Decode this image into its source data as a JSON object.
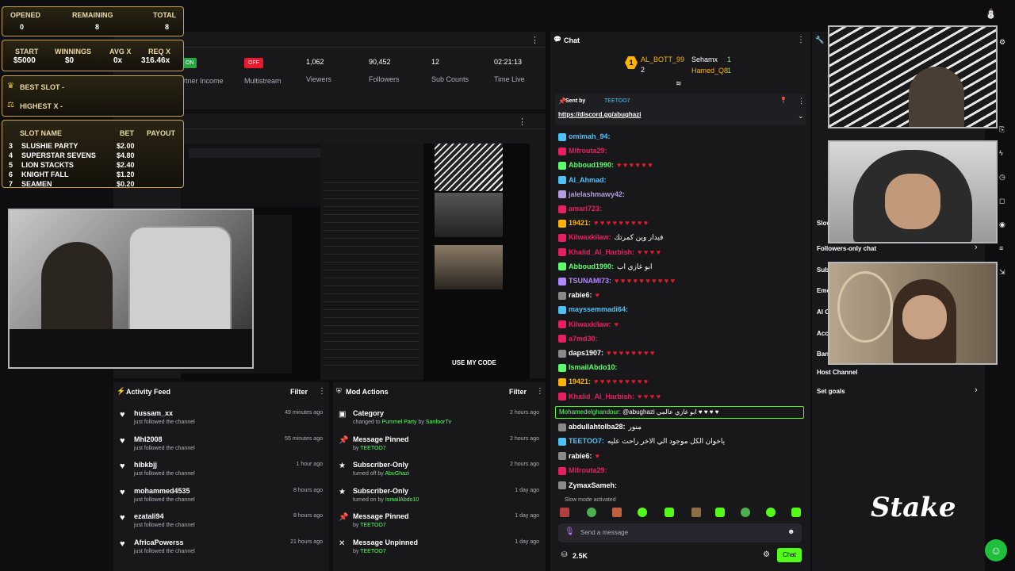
{
  "overlay": {
    "stats_header": {
      "opened_label": "OPENED",
      "remaining_label": "REMAINING",
      "total_label": "TOTAL",
      "opened": "0",
      "remaining": "8",
      "total": "8"
    },
    "money": {
      "start_label": "START",
      "winnings_label": "WINNINGS",
      "avg_label": "AVG X",
      "req_label": "REQ X",
      "start": "$5000",
      "winnings": "$0",
      "avg": "0x",
      "req": "316.46x"
    },
    "best_slot": "BEST SLOT -",
    "highest_x": "HIGHEST X -",
    "slot_table": {
      "headers": [
        "SLOT NAME",
        "BET",
        "PAYOUT"
      ],
      "rows": [
        {
          "n": "3",
          "name": "SLUSHIE PARTY",
          "bet": "$2.00"
        },
        {
          "n": "4",
          "name": "SUPERSTAR SEVENS",
          "bet": "$4.80"
        },
        {
          "n": "5",
          "name": "LION STACKTS",
          "bet": "$2.40"
        },
        {
          "n": "6",
          "name": "KNIGHT FALL",
          "bet": "$1.20"
        },
        {
          "n": "7",
          "name": "SEAMEN",
          "bet": "$0.20"
        }
      ]
    },
    "brand": "Stake"
  },
  "dashboard": {
    "on_label": "ON",
    "off_label": "OFF",
    "partner_income": "rtner Income",
    "multistream": "Multistream",
    "stats": [
      {
        "value": "1,062",
        "label": "Viewers"
      },
      {
        "value": "90,452",
        "label": "Followers"
      },
      {
        "value": "12",
        "label": "Sub Counts"
      },
      {
        "value": "02:21:13",
        "label": "Time Live"
      }
    ]
  },
  "preview": {
    "my_code": "USE MY CODE"
  },
  "activity_feed": {
    "title": "Activity Feed",
    "filter": "Filter",
    "items": [
      {
        "user": "hussam_xx",
        "action": "just followed the channel",
        "time": "49 minutes ago"
      },
      {
        "user": "Mhl2008",
        "action": "just followed the channel",
        "time": "55 minutes ago"
      },
      {
        "user": "hibkbjj",
        "action": "just followed the channel",
        "time": "1 hour ago"
      },
      {
        "user": "mohammed4535",
        "action": "just followed the channel",
        "time": "8 hours ago"
      },
      {
        "user": "ezatali94",
        "action": "just followed the channel",
        "time": "8 hours ago"
      },
      {
        "user": "AfricaPowerss",
        "action": "just followed the channel",
        "time": "21 hours ago"
      }
    ]
  },
  "mod_actions": {
    "title": "Mod Actions",
    "filter": "Filter",
    "items": [
      {
        "title": "Category",
        "pre": "changed to ",
        "value": "Pummel Party",
        "mid": " by ",
        "user": "SanfoorTv",
        "time": "2 hours ago",
        "icon": "category-icon"
      },
      {
        "title": "Message Pinned",
        "pre": "by ",
        "value": "",
        "mid": "",
        "user": "TEETOO7",
        "time": "2 hours ago",
        "icon": "pin-icon"
      },
      {
        "title": "Subscriber-Only",
        "pre": "turned off by ",
        "value": "",
        "mid": "",
        "user": "AbuGhazi",
        "time": "2 hours ago",
        "icon": "subscriber-icon"
      },
      {
        "title": "Subscriber-Only",
        "pre": "turned on by ",
        "value": "",
        "mid": "",
        "user": "IsmailAbdo10",
        "time": "1 day ago",
        "icon": "subscriber-icon"
      },
      {
        "title": "Message Pinned",
        "pre": "by ",
        "value": "",
        "mid": "",
        "user": "TEETOO7",
        "time": "1 day ago",
        "icon": "pin-icon"
      },
      {
        "title": "Message Unpinned",
        "pre": "by ",
        "value": "",
        "mid": "",
        "user": "TEETOO7",
        "time": "1 day ago",
        "icon": "unpin-icon"
      }
    ]
  },
  "chat": {
    "title": "Chat",
    "leaderboard": [
      {
        "rank": "1",
        "name": "AL_BOTT_99",
        "count": "2"
      },
      {
        "name": "Sehamx",
        "count": "1"
      },
      {
        "name": "Hamed_Q8",
        "count": "1"
      }
    ],
    "pinned": {
      "sent_by": "Sent by",
      "user": "TEETOO7",
      "link": "https://discord.gg/abughazi"
    },
    "messages": [
      {
        "user": "omimah_94:",
        "color": "#4fc3f7",
        "text": ""
      },
      {
        "user": "Mlfrouta29:",
        "color": "#e91e63",
        "text": ""
      },
      {
        "user": "Abboud1990:",
        "color": "#5bff6b",
        "text": "♥ ♥ ♥ ♥ ♥ ♥"
      },
      {
        "user": "Al_Ahmad:",
        "color": "#4fc3f7",
        "text": ""
      },
      {
        "user": "jalelashmawy42:",
        "color": "#b39ddb",
        "text": ""
      },
      {
        "user": "amari723:",
        "color": "#e91e63",
        "text": ""
      },
      {
        "user": "19421:",
        "color": "#ffb300",
        "text": "♥ ♥ ♥ ♥ ♥ ♥ ♥ ♥ ♥"
      },
      {
        "user": "Kilwaxkilaw:",
        "color": "#e91e63",
        "text": "فيدار وين كمرتك"
      },
      {
        "user": "Khalid_Al_Harbish:",
        "color": "#e91e63",
        "text": "♥ ♥ ♥ ♥"
      },
      {
        "user": "Abboud1990:",
        "color": "#5bff6b",
        "text": "ابو غازي اب"
      },
      {
        "user": "TSUNAMI73:",
        "color": "#b388ff",
        "text": "♥ ♥ ♥ ♥ ♥ ♥ ♥ ♥ ♥ ♥"
      },
      {
        "user": "rabie6:",
        "color": "#fff",
        "text": "♥"
      },
      {
        "user": "mayssemmadi64:",
        "color": "#4fc3f7",
        "text": ""
      },
      {
        "user": "Kilwaxkilaw:",
        "color": "#e91e63",
        "text": "♥"
      },
      {
        "user": "a7md30:",
        "color": "#e91e63",
        "text": ""
      },
      {
        "user": "daps1907:",
        "color": "#fff",
        "text": "♥ ♥ ♥ ♥ ♥ ♥ ♥ ♥"
      },
      {
        "user": "IsmailAbdo10:",
        "color": "#5bff6b",
        "text": ""
      },
      {
        "user": "19421:",
        "color": "#ffb300",
        "text": "♥ ♥ ♥ ♥ ♥ ♥ ♥ ♥ ♥"
      },
      {
        "user": "Khalid_Al_Harbish:",
        "color": "#e91e63",
        "text": "♥ ♥ ♥ ♥"
      }
    ],
    "highlight": {
      "user": "Mohamedelghandour:",
      "text": "@abughazi ابو غازي عالمي ♥ ♥ ♥ ♥"
    },
    "messages2": [
      {
        "user": "abdullahtolba28:",
        "color": "#fff",
        "text": "منور"
      },
      {
        "user": "TEETOO7:",
        "color": "#4fc3f7",
        "text": "ياخوان الكل موجود الي الاخر راحت عليه"
      },
      {
        "user": "rabie6:",
        "color": "#fff",
        "text": "♥"
      },
      {
        "user": "Mlfrouta29:",
        "color": "#e91e63",
        "text": ""
      },
      {
        "user": "ZymaxSameh:",
        "color": "#fff",
        "text": ""
      }
    ],
    "slow_mode": "Slow mode activated",
    "placeholder": "Send a message",
    "viewers": "2.5K",
    "send": "Chat"
  },
  "settings": {
    "followers_only": "Followers-only chat",
    "host_channel": "Host Channel",
    "set_goals": "Set goals",
    "cut_labels": [
      "Slow",
      "Sub",
      "Emo",
      "Al C",
      "Acc",
      "Ban"
    ]
  },
  "colors": {
    "accent_green": "#53fc18",
    "gold": "#c9a24a",
    "panel": "#18181b",
    "bg": "#0e0e10"
  }
}
